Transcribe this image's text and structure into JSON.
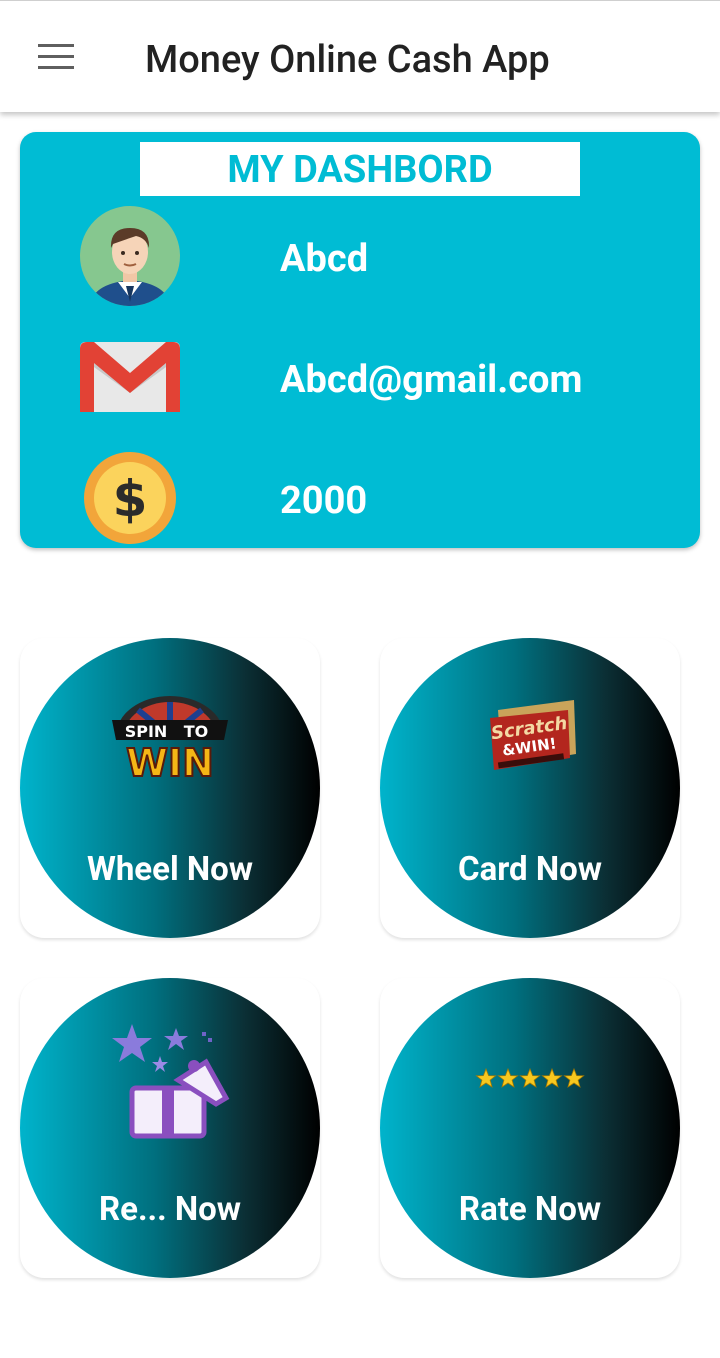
{
  "app_bar": {
    "title": "Money Online Cash App",
    "menu_icon": "hamburger-menu-icon"
  },
  "dashboard": {
    "title": "MY DASHBORD",
    "name": "Abcd",
    "email": "Abcd@gmail.com",
    "coins": "2000",
    "background_color": "#00bcd4",
    "icons": [
      "user-avatar-icon",
      "gmail-icon",
      "dollar-coin-icon"
    ]
  },
  "tiles": [
    {
      "label": "Wheel Now",
      "icon": "spin-to-win-logo",
      "logo_text": [
        "SPIN",
        "TO",
        "WIN"
      ]
    },
    {
      "label": "Card Now",
      "icon": "scratch-and-win-logo",
      "logo_text": [
        "Scratch",
        "&WIN!"
      ]
    },
    {
      "label": "Re... Now",
      "icon": "gift-box-stars-icon"
    },
    {
      "label": "Rate Now",
      "icon": "five-stars-icon"
    }
  ]
}
